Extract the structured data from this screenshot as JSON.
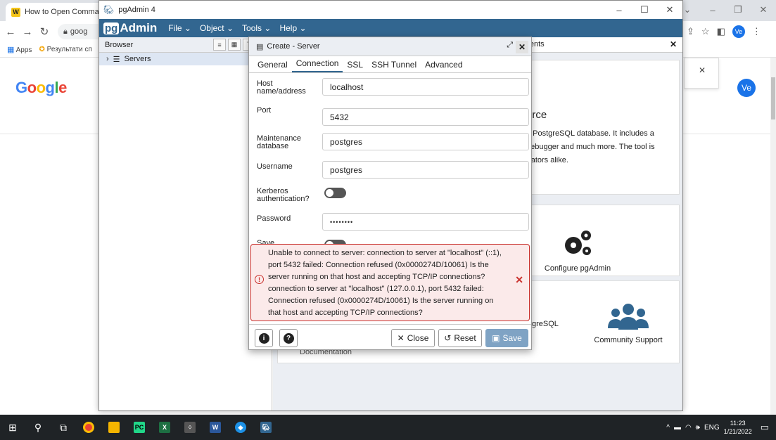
{
  "chrome": {
    "tab_title": "How to Open Command",
    "omnibox_text": "goog",
    "bookmarks": [
      "Apps",
      "Результати сп"
    ],
    "profile_initials": "Ve",
    "google_logo": "Google"
  },
  "pgadmin": {
    "window_title": "pgAdmin 4",
    "logo_pg": "pg",
    "logo_admin": "Admin",
    "menu": [
      "File",
      "Object",
      "Tools",
      "Help"
    ],
    "browser_title": "Browser",
    "tree_root": "Servers",
    "right_tab_fragment": "lients",
    "dashboard": {
      "source_title": "urce",
      "source_desc": "e PostgreSQL database. It includes a debugger and much more. The tool is trators alike.",
      "configure_label": "Configure pgAdmin",
      "postgresql_label": "greSQL",
      "community_label": "Community Support",
      "documentation_label": "Documentation"
    }
  },
  "dialog": {
    "title": "Create - Server",
    "tabs": [
      "General",
      "Connection",
      "SSL",
      "SSH Tunnel",
      "Advanced"
    ],
    "active_tab": "Connection",
    "fields": {
      "host_label": "Host name/address",
      "host_value": "localhost",
      "port_label": "Port",
      "port_value": "5432",
      "maint_db_label": "Maintenance database",
      "maint_db_value": "postgres",
      "username_label": "Username",
      "username_value": "postgres",
      "kerberos_label": "Kerberos authentication?",
      "password_label": "Password",
      "password_value": "••••••••",
      "save_label": "Save"
    },
    "error_message": "Unable to connect to server: connection to server at \"localhost\" (::1), port 5432 failed: Connection refused (0x0000274D/10061) Is the server running on that host and accepting TCP/IP connections? connection to server at \"localhost\" (127.0.0.1), port 5432 failed: Connection refused (0x0000274D/10061) Is the server running on that host and accepting TCP/IP connections?",
    "buttons": {
      "close": "Close",
      "reset": "Reset",
      "save": "Save"
    }
  },
  "taskbar": {
    "language": "ENG",
    "time": "11:23",
    "date": "1/21/2022"
  },
  "colors": {
    "pg_blue": "#326690",
    "error_red": "#c9302c",
    "save_btn": "#7fa3c4"
  }
}
